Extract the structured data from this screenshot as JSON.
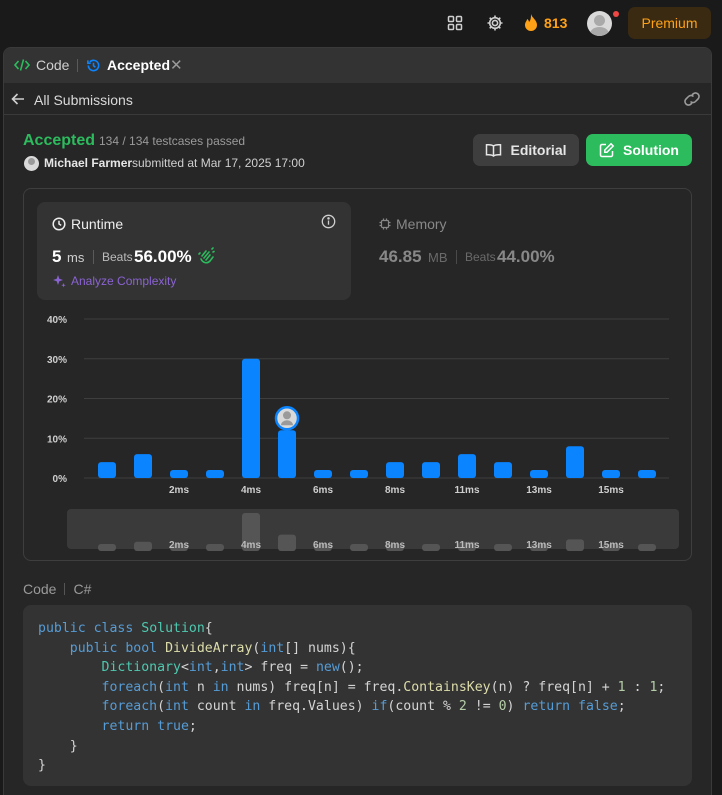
{
  "topbar": {
    "streak_count": "813",
    "premium_label": "Premium"
  },
  "tabs": {
    "code_label": "Code",
    "accepted_label": "Accepted"
  },
  "subbar": {
    "all_submissions_label": "All Submissions"
  },
  "submission": {
    "status": "Accepted",
    "testcases": "134 / 134 testcases passed",
    "user_name": "Michael Farmer",
    "submitted_text": "submitted at Mar 17, 2025 17:00"
  },
  "actions": {
    "editorial_label": "Editorial",
    "solution_label": "Solution"
  },
  "runtime": {
    "title": "Runtime",
    "value": "5",
    "unit": "ms",
    "beats_label": "Beats",
    "beats_value": "56.00%",
    "analyze_label": "Analyze Complexity"
  },
  "memory": {
    "title": "Memory",
    "value": "46.85",
    "unit": "MB",
    "beats_label": "Beats",
    "beats_value": "44.00%"
  },
  "colors": {
    "accent_green": "#2cbb5d",
    "bar_blue": "#0a84ff",
    "premium_orange": "#ffa116"
  },
  "chart_data": {
    "type": "bar",
    "values": [
      4,
      6,
      2,
      2,
      30,
      12,
      2,
      2,
      4,
      4,
      6,
      4,
      2,
      8,
      2,
      2
    ],
    "x_ticks": [
      {
        "index": 2,
        "label": "2ms"
      },
      {
        "index": 4,
        "label": "4ms"
      },
      {
        "index": 6,
        "label": "6ms"
      },
      {
        "index": 8,
        "label": "8ms"
      },
      {
        "index": 10,
        "label": "11ms"
      },
      {
        "index": 12,
        "label": "13ms"
      },
      {
        "index": 14,
        "label": "15ms"
      }
    ],
    "y_ticks": [
      "0%",
      "10%",
      "20%",
      "30%",
      "40%"
    ],
    "ylim": [
      0,
      40
    ],
    "highlight_index": 5,
    "grid": true
  },
  "code": {
    "label": "Code",
    "language": "C#",
    "lines": [
      "public class Solution{",
      "    public bool DivideArray(int[] nums){",
      "        Dictionary<int,int> freq = new();",
      "        foreach(int n in nums) freq[n] = freq.ContainsKey(n) ? freq[n] + 1 : 1;",
      "        foreach(int count in freq.Values) if(count % 2 != 0) return false;",
      "        return true;",
      "    }",
      "}"
    ]
  }
}
